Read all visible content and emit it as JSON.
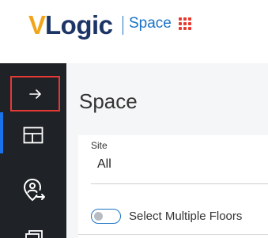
{
  "header": {
    "logo_v": "V",
    "logo_text": "Logic",
    "product_name": "Space"
  },
  "sidebar": {
    "items": [
      {
        "name": "expand",
        "icon": "arrow-right-icon"
      },
      {
        "name": "floor-plan",
        "icon": "floor-plan-icon",
        "active": true
      },
      {
        "name": "people",
        "icon": "person-location-icon"
      },
      {
        "name": "more",
        "icon": "stack-icon"
      }
    ]
  },
  "main": {
    "title": "Space",
    "site_label": "Site",
    "site_value": "All",
    "toggle_label": "Select Multiple Floors",
    "toggle_on": false
  },
  "colors": {
    "brand_orange": "#f2a51a",
    "brand_navy": "#1d3566",
    "accent_blue": "#1a73c8",
    "app_grid_red": "#e8392e",
    "sidebar_bg": "#1f2226",
    "highlight_red": "#e53935"
  }
}
